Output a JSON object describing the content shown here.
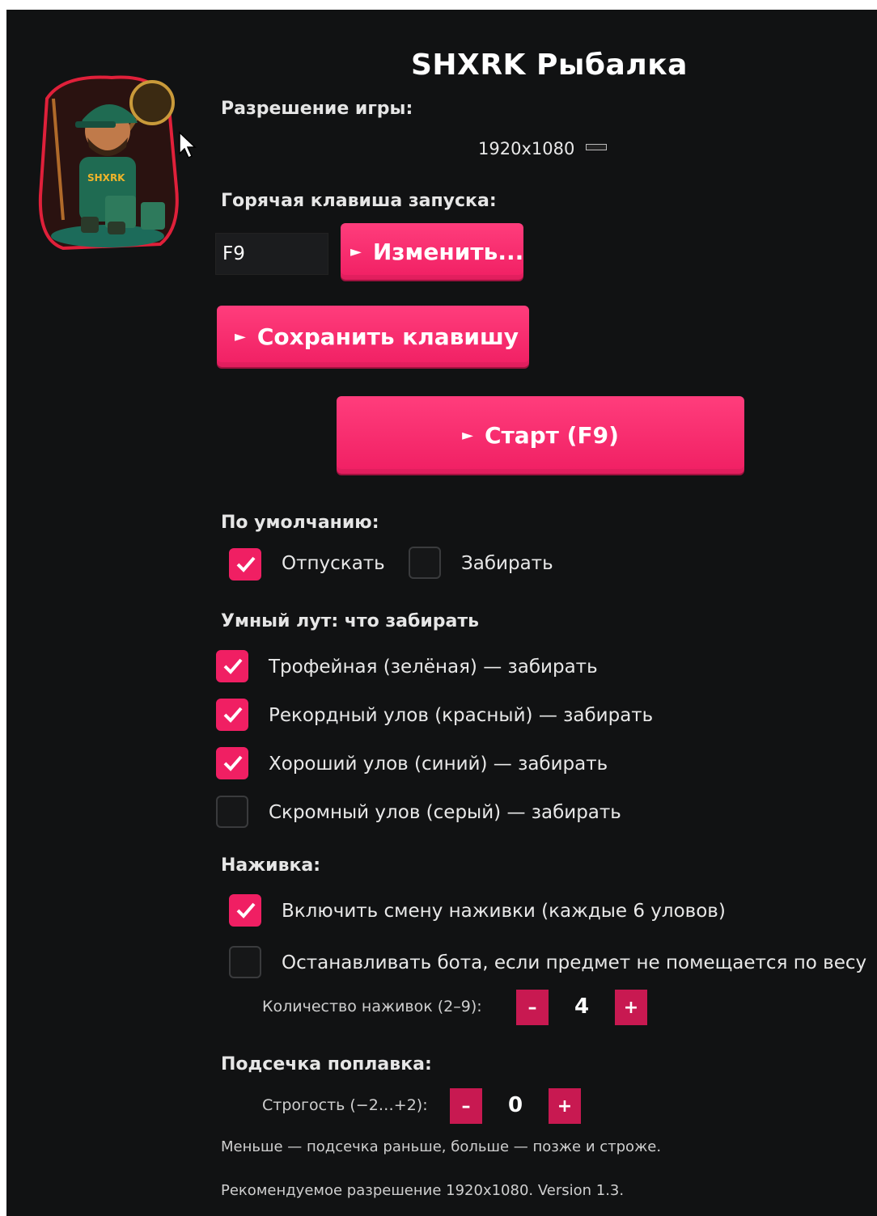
{
  "app": {
    "title": "SHXRK Рыбалка",
    "logo_text": "SHXRK",
    "accent_color": "#f01f63"
  },
  "resolution": {
    "label": "Разрешение игры:",
    "value": "1920x1080"
  },
  "hotkey": {
    "label": "Горячая клавиша запуска:",
    "value": "F9",
    "change_label": "Изменить...",
    "save_label": "Сохранить клавишу"
  },
  "start_label": "Старт (F9)",
  "defaults": {
    "label": "По умолчанию:",
    "options": [
      {
        "label": "Отпускать",
        "checked": true
      },
      {
        "label": "Забирать",
        "checked": false
      }
    ]
  },
  "smart_loot": {
    "label": "Умный лут: что забирать",
    "items": [
      {
        "label": "Трофейная (зелёная) — забирать",
        "checked": true
      },
      {
        "label": "Рекордный улов (красный) — забирать",
        "checked": true
      },
      {
        "label": "Хороший улов (синий) — забирать",
        "checked": true
      },
      {
        "label": "Скромный улов (серый) — забирать",
        "checked": false
      }
    ]
  },
  "bait": {
    "label": "Наживка:",
    "options": [
      {
        "label": "Включить смену наживки (каждые 6 уловов)",
        "checked": true
      },
      {
        "label": "Останавливать бота, если предмет не помещается по весу",
        "checked": false
      }
    ],
    "count_label": "Количество наживок (2–9):",
    "count_value": "4",
    "minus": "–",
    "plus": "+"
  },
  "hook": {
    "label": "Подсечка поплавка:",
    "strictness_label": "Строгость (−2…+2):",
    "strictness_value": "0",
    "minus": "–",
    "plus": "+",
    "hint": "Меньше — подсечка раньше, больше — позже и строже."
  },
  "footer": "Рекомендуемое разрешение 1920x1080. Version 1.3."
}
